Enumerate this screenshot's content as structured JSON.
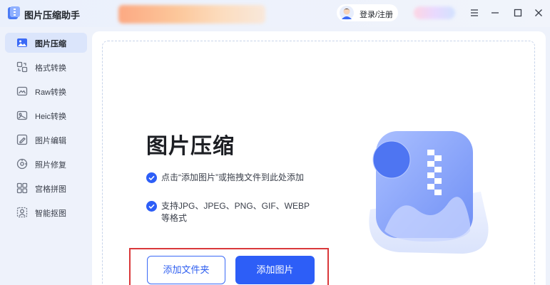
{
  "app": {
    "title": "图片压缩助手",
    "login_label": "登录/注册",
    "icon": "app-logo-icon"
  },
  "window_controls": [
    "menu-icon",
    "minimize-icon",
    "maximize-icon",
    "close-icon"
  ],
  "sidebar": {
    "items": [
      {
        "label": "图片压缩",
        "icon": "image-compress-icon",
        "active": true
      },
      {
        "label": "格式转换",
        "icon": "format-convert-icon",
        "active": false
      },
      {
        "label": "Raw转换",
        "icon": "raw-icon",
        "active": false
      },
      {
        "label": "Heic转换",
        "icon": "heic-icon",
        "active": false
      },
      {
        "label": "图片编辑",
        "icon": "image-edit-icon",
        "active": false
      },
      {
        "label": "照片修复",
        "icon": "photo-repair-icon",
        "active": false
      },
      {
        "label": "宫格拼图",
        "icon": "grid-collage-icon",
        "active": false
      },
      {
        "label": "智能抠图",
        "icon": "smart-cutout-icon",
        "active": false
      }
    ]
  },
  "main": {
    "title": "图片压缩",
    "features": [
      "点击“添加图片”或拖拽文件到此处添加",
      "支持JPG、JPEG、PNG、GIF、WEBP等格式"
    ],
    "add_folder_label": "添加文件夹",
    "add_image_label": "添加图片"
  },
  "colors": {
    "accent": "#2d5ef7",
    "highlight": "#d9383a",
    "sidebar_active": "#dbe5fb",
    "background": "#eef2fb"
  }
}
